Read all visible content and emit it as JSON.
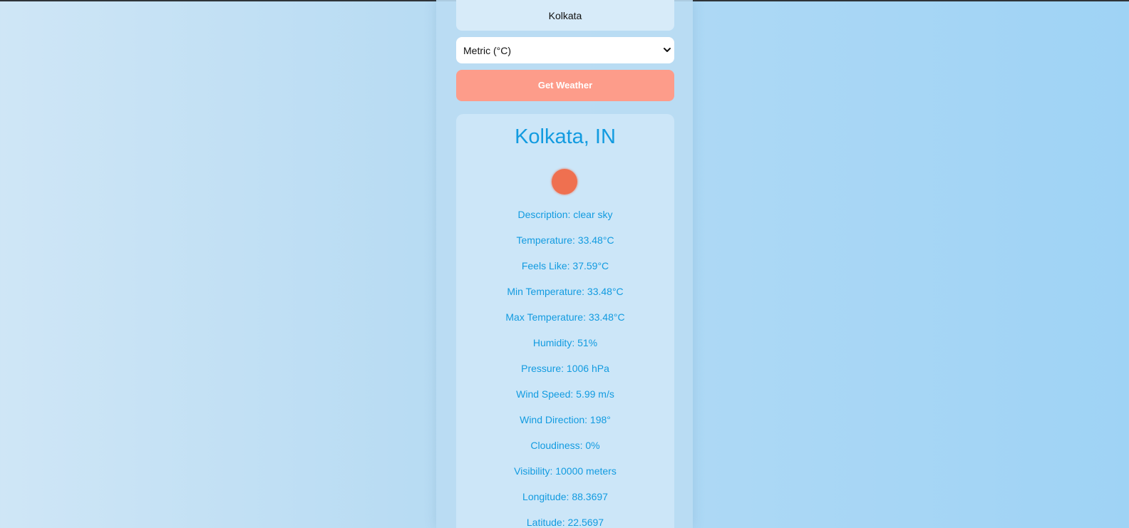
{
  "search": {
    "city_value": "Kolkata",
    "unit_selected": "Metric (°C)",
    "button_label": "Get Weather"
  },
  "result": {
    "location": "Kolkata, IN",
    "icon": "sun-icon",
    "details": [
      "Description: clear sky",
      "Temperature: 33.48°C",
      "Feels Like: 37.59°C",
      "Min Temperature: 33.48°C",
      "Max Temperature: 33.48°C",
      "Humidity: 51%",
      "Pressure: 1006 hPa",
      "Wind Speed: 5.99 m/s",
      "Wind Direction: 198°",
      "Cloudiness: 0%",
      "Visibility: 10000 meters",
      "Longitude: 88.3697",
      "Latitude: 22.5697"
    ]
  },
  "colors": {
    "accent_text": "#129be0",
    "button_bg": "#fd9c8a",
    "icon_color": "#ef7050"
  }
}
